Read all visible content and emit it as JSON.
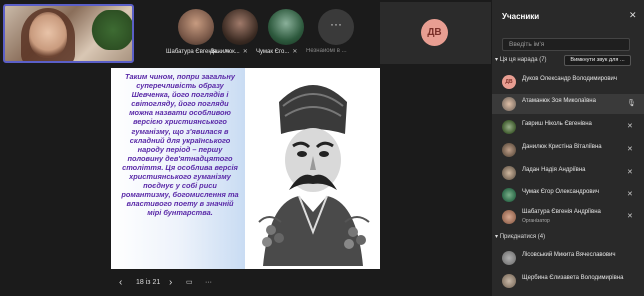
{
  "panel": {
    "title": "Учасники",
    "search_placeholder": "Введіть ім'я",
    "mute_all_label": "Вимкнути звук для ...",
    "in_meeting_label": "Ця ця нарада (7)",
    "invited_label": "Приєднатися (4)",
    "participants": [
      {
        "initials": "ДВ",
        "name": "Дуков Олександр Володимирович",
        "role": "",
        "avatar_color": "#e89e92"
      },
      {
        "initials": "",
        "name": "Атаманюк Зоя Миколаївна",
        "role": "",
        "avatar_color": "#8c7b6e"
      },
      {
        "initials": "",
        "name": "Гавриш Ніколь Євгенівна",
        "role": "",
        "avatar_color": "#3f5b2e"
      },
      {
        "initials": "",
        "name": "Данилюк Кристіна Віталіївна",
        "role": "",
        "avatar_color": "#6d5a4a"
      },
      {
        "initials": "",
        "name": "Ладан Надія Андріївна",
        "role": "",
        "avatar_color": "#7a6a5a"
      },
      {
        "initials": "",
        "name": "Чумак Єгор Олександрович",
        "role": "",
        "avatar_color": "#2e6a4a"
      },
      {
        "initials": "",
        "name": "Шабатура Євгенія Андріївна",
        "role": "Організатор",
        "avatar_color": "#9a6b55"
      }
    ],
    "invited": [
      {
        "name": "Лісовський Микита Вячеславович",
        "avatar_color": "#7d7d7d"
      },
      {
        "name": "Щербина Єлизавета Володимирівна",
        "avatar_color": "#8a7a6a"
      }
    ]
  },
  "gallery": {
    "tiles": [
      {
        "label": "Шабатура Євгенія...",
        "avatar_color": "#7b5a4a"
      },
      {
        "label": "Данилюк...",
        "avatar_color": "#3a2a22"
      },
      {
        "label": "Чумак Єго...",
        "avatar_color": "#2e5a3e"
      },
      {
        "label": "Незнайомі в ...",
        "avatar_color": "#3a3a3a"
      }
    ],
    "dv_initials": "ДВ"
  },
  "slide": {
    "text": "Таким чином, попри загальну суперечливість образу Шевченка, його поглядів і світогляду, його погляди можна назвати особливою версією християнського гуманізму, що з'явилася в складний для українського народу період – першу половину дев'ятнадцятого століття. Ця особлива версія християнського гуманізму поєднує у собі риси романтизму, богомислення та властивого поету в значній мірі бунтарства."
  },
  "slide_controls": {
    "prev": "‹",
    "page": "18 із 21",
    "next": "›",
    "more": "···"
  },
  "icons": {
    "mic_off": "mic-off-icon",
    "mic_on": "mic-on-icon",
    "close": "close-icon",
    "chevron": "chevron-down-icon"
  }
}
